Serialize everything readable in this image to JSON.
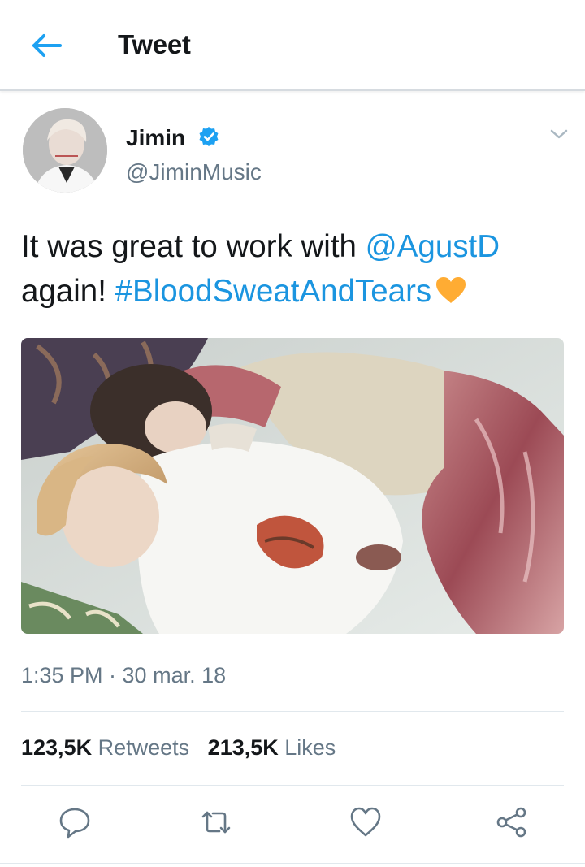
{
  "header": {
    "title": "Tweet",
    "back_icon": "arrow-left-icon"
  },
  "author": {
    "display_name": "Jimin",
    "handle": "@JiminMusic",
    "verified": true
  },
  "tweet": {
    "text_part1": "It was great to work with ",
    "mention": "@AgustD",
    "text_part2": "again! ",
    "hashtag": "#BloodSweatAndTears",
    "emoji": "yellow-heart",
    "timestamp": "1:35 PM · 30 mar. 18"
  },
  "stats": {
    "retweets_count": "123,5K",
    "retweets_label": "Retweets",
    "likes_count": "213,5K",
    "likes_label": "Likes"
  },
  "actions": [
    "reply-icon",
    "retweet-icon",
    "like-icon",
    "share-icon"
  ],
  "colors": {
    "accent": "#1b95e0",
    "text": "#14171a",
    "secondary": "#657786",
    "divider": "#e1e8ed",
    "emoji_heart": "#ffac33"
  }
}
